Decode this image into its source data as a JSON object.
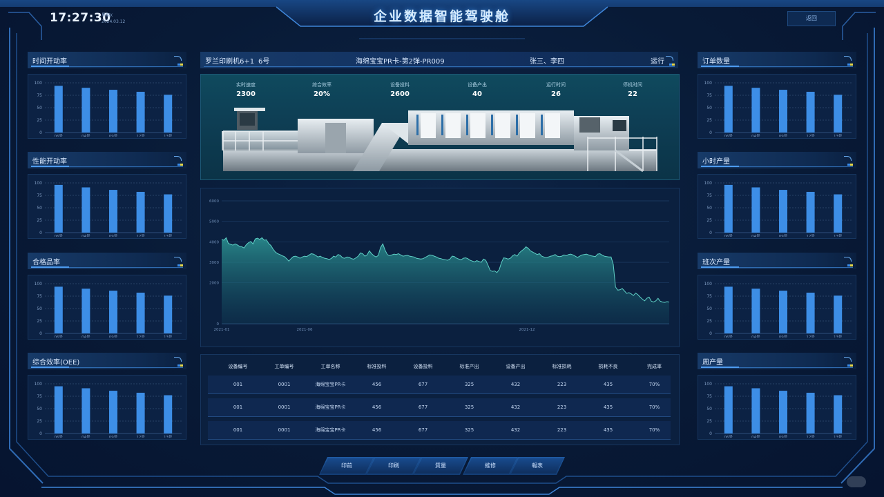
{
  "header": {
    "time": "17:27:30",
    "weekday": "星期X",
    "date": "2024.03.12",
    "title": "企业数据智能驾驶舱",
    "back_label": "返回"
  },
  "colors": {
    "background": "#081a36",
    "panel": "#0c2244",
    "bar": "#3d8ee6",
    "line": "#3fb8b0",
    "accent": "#4d9bf0"
  },
  "bar_categories": [
    "06号",
    "04号",
    "09号",
    "12号",
    "13号"
  ],
  "bar_ticks": [
    "100",
    "75",
    "50",
    "25",
    "0"
  ],
  "left_panels": [
    {
      "title": "时间开动率",
      "values": [
        94,
        90,
        86,
        82,
        76
      ]
    },
    {
      "title": "性能开动率",
      "values": [
        96,
        91,
        86,
        82,
        77
      ]
    },
    {
      "title": "合格品率",
      "values": [
        94,
        90,
        86,
        82,
        76
      ]
    },
    {
      "title": "综合效率(OEE)",
      "values": [
        95,
        91,
        86,
        82,
        77
      ]
    }
  ],
  "right_panels": [
    {
      "title": "订单数量",
      "values": [
        94,
        90,
        86,
        82,
        76
      ]
    },
    {
      "title": "小时产量",
      "values": [
        96,
        91,
        86,
        82,
        77
      ]
    },
    {
      "title": "班次产量",
      "values": [
        94,
        90,
        86,
        82,
        76
      ]
    },
    {
      "title": "周产量",
      "values": [
        95,
        91,
        86,
        82,
        77
      ]
    }
  ],
  "machine_info": {
    "name": "罗兰印刷机6+1",
    "number": "6号",
    "job": "海绵宝宝PR卡-第2弹-PR009",
    "operators": "张三、李四",
    "status": "运行"
  },
  "machine_stats": [
    {
      "label": "实时速度",
      "value": "2300"
    },
    {
      "label": "综合效率",
      "value": "20%"
    },
    {
      "label": "设备投料",
      "value": "2600"
    },
    {
      "label": "设备产出",
      "value": "40"
    },
    {
      "label": "运行时间",
      "value": "26"
    },
    {
      "label": "停机时间",
      "value": "22"
    }
  ],
  "chart_data": {
    "type": "area",
    "y_ticks": [
      "6000",
      "5000",
      "4000",
      "3000",
      "2000",
      "0"
    ],
    "x_ticks": [
      "2021-01",
      "2021-06",
      "2021-12"
    ],
    "ylim": [
      0,
      6000
    ],
    "values": [
      4120,
      4080,
      4200,
      3920,
      3880,
      3840,
      3900,
      3850,
      3780,
      3760,
      3700,
      3860,
      3960,
      4020,
      3900,
      4140,
      4180,
      4120,
      4200,
      4080,
      4100,
      3920,
      3820,
      3640,
      3500,
      3420,
      3380,
      3320,
      3280,
      3180,
      3060,
      3180,
      3280,
      3300,
      3260,
      3200,
      3260,
      3300,
      3280,
      3350,
      3420,
      3400,
      3340,
      3260,
      3300,
      3240,
      3200,
      3180,
      3140,
      3190,
      3300,
      3260,
      3380,
      3340,
      3220,
      3200,
      3260,
      3240,
      3180,
      3150,
      3220,
      3300,
      3460,
      3420,
      3300,
      3360,
      3560,
      3420,
      3320,
      3260,
      3340,
      3720,
      3900,
      3600,
      3380,
      3320,
      3360,
      3400,
      3380,
      3420,
      3360,
      3300,
      3320,
      3340,
      3300,
      3280,
      3260,
      3200,
      3180,
      3160,
      3180,
      3240,
      3300,
      3360,
      3340,
      3300,
      3260,
      3200,
      3180,
      3140,
      3120,
      3100,
      3160,
      3300,
      3280,
      3200,
      3160,
      3120,
      3200,
      3220,
      3180,
      3100,
      3060,
      3020,
      3080,
      3040,
      3000,
      3160,
      3100,
      2860,
      2600,
      2560,
      2580,
      2500,
      2640,
      2980,
      3220,
      3200,
      3160,
      3200,
      3320,
      3380,
      3300,
      3460,
      3560,
      3640,
      3760,
      3680,
      3560,
      3500,
      3440,
      3380,
      3420,
      3300,
      3260,
      3220,
      3260,
      3300,
      3320,
      3380,
      3300,
      3280,
      3300,
      3360,
      3320,
      3380,
      3400,
      3360,
      3300,
      3240,
      3300,
      3360,
      3380,
      3400,
      3360,
      3320,
      3300,
      3280,
      3400,
      3420,
      3350,
      3300,
      3280,
      3260,
      3260,
      2900,
      1800,
      1640,
      1660,
      1720,
      1600,
      1480,
      1520,
      1460,
      1380,
      1500,
      1420,
      1300,
      1200,
      1120,
      1240,
      1300,
      1100,
      1060,
      1120,
      1240,
      1100,
      1060,
      1040,
      1080,
      1060
    ]
  },
  "table": {
    "headers": [
      "设备编号",
      "工单编号",
      "工单名称",
      "标准投料",
      "设备投料",
      "标准产出",
      "设备产出",
      "标准损耗",
      "损耗不良",
      "完成率"
    ],
    "rows": [
      [
        "001",
        "0001",
        "海绵宝宝PR卡",
        "456",
        "677",
        "325",
        "432",
        "223",
        "435",
        "70%"
      ],
      [
        "001",
        "0001",
        "海绵宝宝PR卡",
        "456",
        "677",
        "325",
        "432",
        "223",
        "435",
        "70%"
      ],
      [
        "001",
        "0001",
        "海绵宝宝PR卡",
        "456",
        "677",
        "325",
        "432",
        "223",
        "435",
        "70%"
      ]
    ]
  },
  "bottom_nav": [
    "印前",
    "印刷",
    "質量",
    "維修",
    "報表"
  ]
}
